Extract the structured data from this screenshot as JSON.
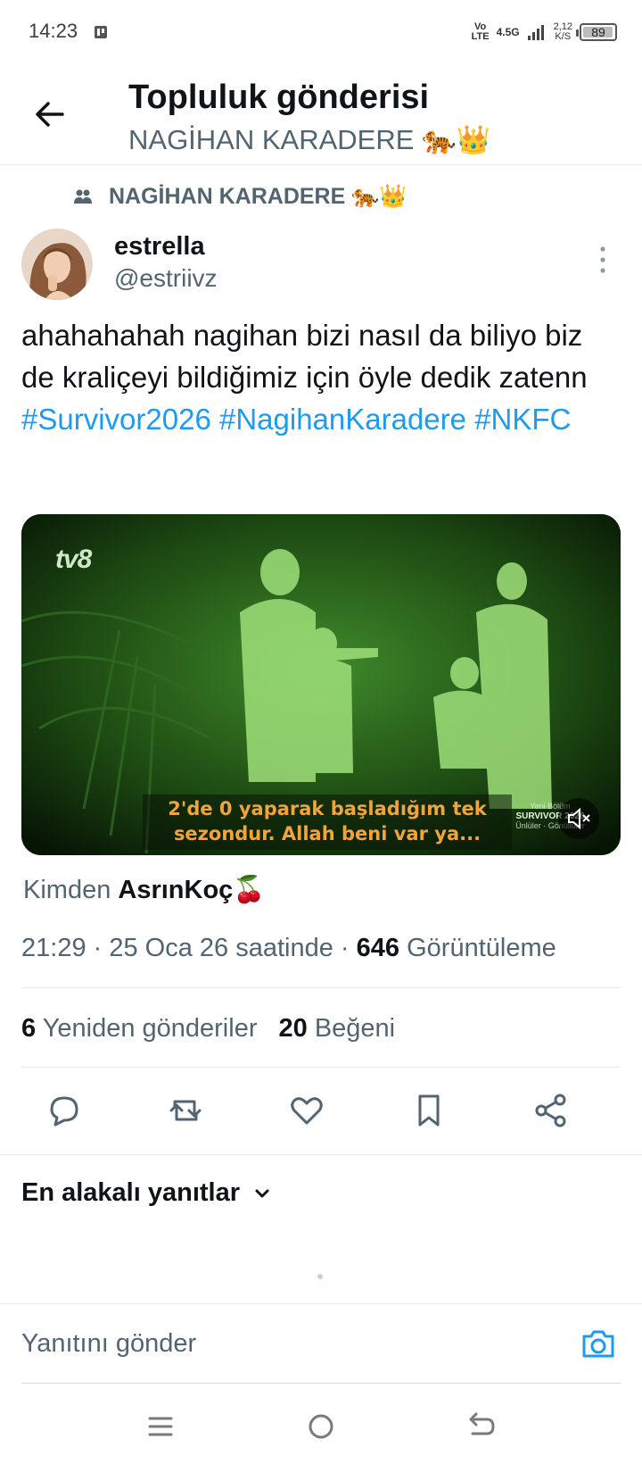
{
  "status_bar": {
    "time": "14:23",
    "volte_top": "Vo",
    "volte_bottom": "LTE",
    "network": "4.5G",
    "speed_top": "2,12",
    "speed_bottom": "K/S",
    "battery": "89"
  },
  "header": {
    "title": "Topluluk gönderisi",
    "subtitle": "NAGİHAN KARADERE 🐅👑"
  },
  "post": {
    "community": "NAGİHAN KARADERE 🐅👑",
    "display_name": "estrella",
    "handle": "@estriivz",
    "text_plain": "ahahahahah nagihan bizi nasıl da biliyo biz de kraliçeyi bildiğimiz için öyle dedik zatenn",
    "hashtag_1": "#Survivor2026",
    "hashtag_2": "#NagihanKaradere",
    "hashtag_3": "#NKFC",
    "media": {
      "watermark": "tv8",
      "subtitle_line1": "2'de 0 yaparak başladığım tek",
      "subtitle_line2": "sezondur. Allah beni var ya...",
      "brand_line1": "Yeni Bölüm",
      "brand_line2": "SURVIVOR 2026",
      "brand_line3": "Ünlüler · Gönüllüler"
    },
    "source_prefix": "Kimden",
    "source_name": "AsrınKoç🍒",
    "time": "21:29",
    "date": "25 Oca 26 saatinde",
    "views": "646",
    "views_label": "Görüntüleme",
    "reposts": "6",
    "reposts_label": "Yeniden gönderiler",
    "likes": "20",
    "likes_label": "Beğeni"
  },
  "replies": {
    "sort_label": "En alakalı yanıtlar",
    "reply_placeholder": "Yanıtını gönder"
  },
  "colors": {
    "accent": "#1d9bf0",
    "text": "#0f1419",
    "secondary": "#536471"
  }
}
